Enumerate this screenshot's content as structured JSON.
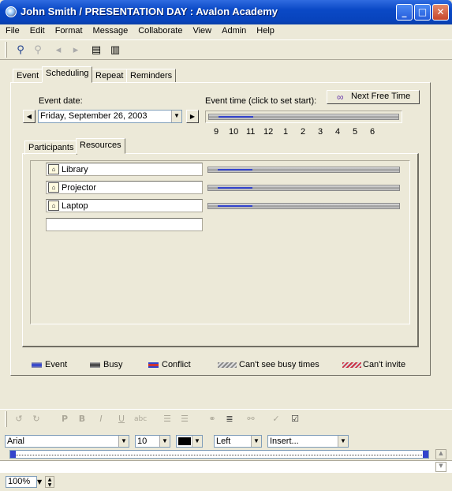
{
  "window": {
    "title": "John Smith / PRESENTATION DAY : Avalon Academy",
    "minimize": "_",
    "maximize": "□",
    "close": "✕"
  },
  "menu": [
    "File",
    "Edit",
    "Format",
    "Message",
    "Collaborate",
    "View",
    "Admin",
    "Help"
  ],
  "tabs": [
    "Event",
    "Scheduling",
    "Repeat",
    "Reminders"
  ],
  "active_tab": "Scheduling",
  "scheduling": {
    "event_date_label": "Event date:",
    "event_date_value": "Friday, September 26, 2003",
    "event_time_label": "Event time (click to set start):",
    "next_free_time": "Next Free Time",
    "hours": [
      "9",
      "10",
      "11",
      "12",
      "1",
      "2",
      "3",
      "4",
      "5",
      "6"
    ],
    "subtabs": [
      "Participants",
      "Resources"
    ],
    "active_subtab": "Resources",
    "resources": [
      "Library",
      "Projector",
      "Laptop"
    ],
    "new_resource_value": ""
  },
  "legend": [
    "Event",
    "Busy",
    "Conflict",
    "Can't see busy times",
    "Can't invite"
  ],
  "legend_colors": {
    "event": "#3344cc",
    "busy": "#444444",
    "conflict": "#cc3333",
    "cant_see": "#888888",
    "cant_invite": "#cc3344"
  },
  "format": {
    "font": "Arial",
    "size": "10",
    "color": "#000000",
    "align": "Left",
    "insert": "Insert..."
  },
  "zoom": "100%"
}
